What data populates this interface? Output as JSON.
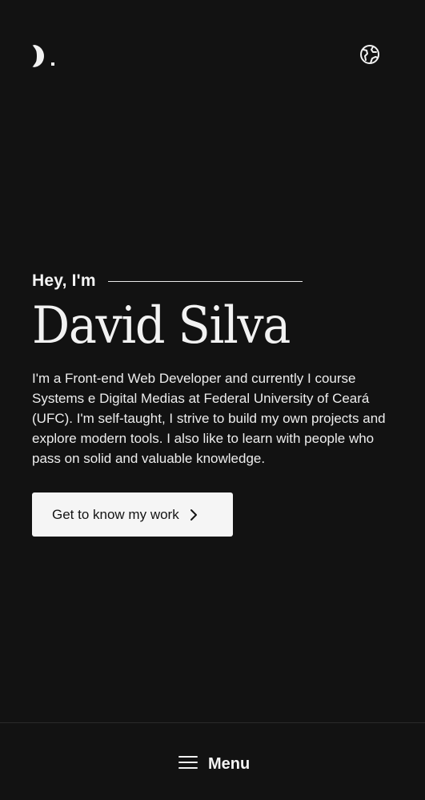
{
  "header": {
    "logo_icon": "logo-mark-icon",
    "language_icon": "globe-icon"
  },
  "hero": {
    "greeting": "Hey, I'm",
    "name": "David Silva",
    "bio": "I'm a Front-end Web Developer and currently I course Systems e Digital Medias at Federal University of Ceará (UFC). I'm self-taught, I strive to build my own projects and explore modern tools. I also like to learn with people who pass on solid and valuable knowledge.",
    "cta_label": "Get to know my work",
    "cta_icon": "chevron-right-icon"
  },
  "bottom_nav": {
    "menu_label": "Menu",
    "menu_icon": "hamburger-icon"
  },
  "colors": {
    "background": "#121212",
    "text": "#f2f2f2",
    "button_bg": "#f5f5f5",
    "button_text": "#141414"
  }
}
